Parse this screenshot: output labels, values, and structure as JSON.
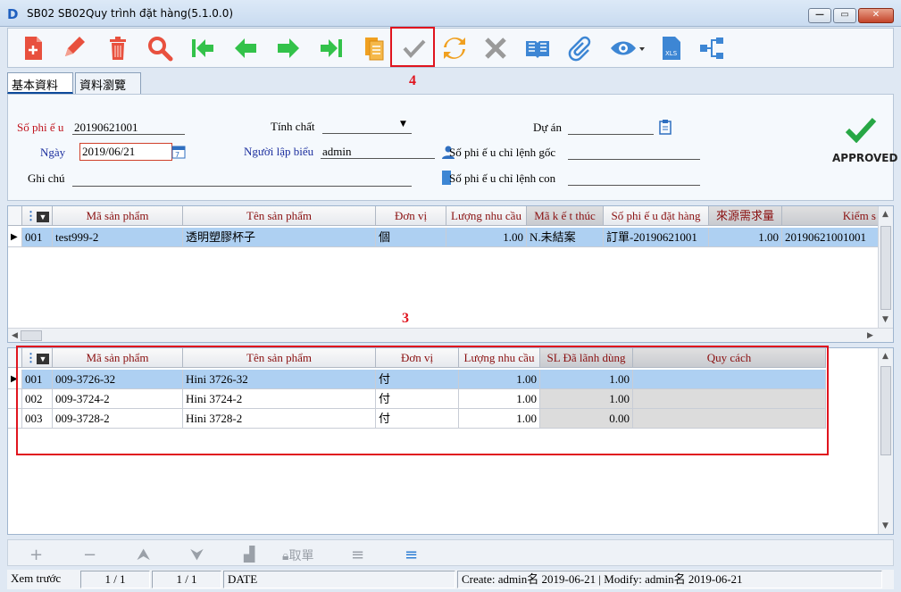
{
  "window": {
    "title": "SB02 SB02Quy trình đặt hàng(5.1.0.0)",
    "logo": "D",
    "min": "—",
    "max": "▭",
    "close": "✕"
  },
  "toolbar": {
    "buttons": [
      "new-file-icon",
      "edit-pencil-icon",
      "delete-trash-icon",
      "search-magnifier-icon",
      "first-record-icon",
      "previous-record-icon",
      "next-record-icon",
      "last-record-icon",
      "copy-document-icon",
      "approve-check-icon",
      "refresh-cycle-icon",
      "cancel-x-icon",
      "book-icon",
      "attachment-clip-icon",
      "view-eye-icon",
      "export-xls-icon",
      "flow-tree-icon"
    ]
  },
  "annotations": {
    "box4": "4",
    "box3": "3"
  },
  "tabs": [
    {
      "label": "基本資料",
      "active": true
    },
    {
      "label": "資料瀏覽",
      "active": false
    }
  ],
  "form": {
    "so_phieu_label": "Số phi ế u",
    "so_phieu_value": "20190621001",
    "ngay_label": "Ngày",
    "ngay_value": "2019/06/21",
    "ghi_chu_label": "Ghi chú",
    "ghi_chu_value": "",
    "tinh_chat_label": "Tính chất",
    "tinh_chat_value": "",
    "nguoi_lap_label": "Người lập biểu",
    "nguoi_lap_value": "admin",
    "du_an_label": "Dự án",
    "du_an_value": "",
    "so_phieu_goc_label": "Số phi ế u chỉ lệnh gốc",
    "so_phieu_goc_value": "",
    "so_phieu_con_label": "Số phi ế u chỉ lệnh con",
    "so_phieu_con_value": "",
    "status": "APPROVED"
  },
  "upper_grid": {
    "headers": [
      "Mã sản phẩm",
      "Tên sản phẩm",
      "Đơn vị",
      "Lượng nhu cầu",
      "Mã k ế t thúc",
      "Số phi ế u đặt hàng",
      "來源需求量",
      "Kiểm s"
    ],
    "rows": [
      [
        "001",
        "test999-2",
        "透明塑膠杯子",
        "個",
        "1.00",
        "N.未結案",
        "訂單-20190621001",
        "1.00",
        "20190621001001"
      ]
    ]
  },
  "lower_grid": {
    "headers": [
      "Mã sản phẩm",
      "Tên sản phẩm",
      "Đơn vị",
      "Lượng nhu cầu",
      "SL Đã lãnh dùng",
      "Quy cách"
    ],
    "rows": [
      [
        "001",
        "009-3726-32",
        "Hini 3726-32",
        "付",
        "1.00",
        "1.00",
        ""
      ],
      [
        "002",
        "009-3724-2",
        "Hini 3724-2",
        "付",
        "1.00",
        "1.00",
        ""
      ],
      [
        "003",
        "009-3728-2",
        "Hini 3728-2",
        "付",
        "1.00",
        "0.00",
        ""
      ]
    ]
  },
  "navbar": {
    "add": "+",
    "remove": "−",
    "up": "⮝",
    "down": "⮟",
    "lock_label": "取單"
  },
  "status_bar": {
    "prev_label": "Xem trước",
    "page1": "1 / 1",
    "page2": "1 / 1",
    "date_label": "DATE",
    "create_modify": "Create: admin名 2019-06-21 | Modify: admin名 2019-06-21"
  }
}
